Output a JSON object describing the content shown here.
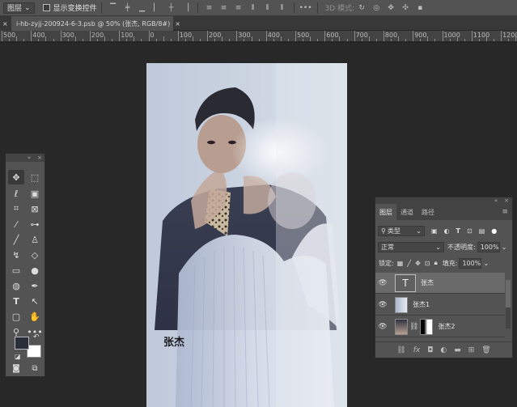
{
  "options_bar": {
    "layer_dropdown": "图层",
    "show_transform_label": "显示变换控件",
    "mode_3d_label": "3D 模式:"
  },
  "document": {
    "tab_title": "i-hb-zyjj-200924-6-3.psb @ 50% (张杰, RGB/8#)",
    "tab_close": "×",
    "canvas_text": "张杰"
  },
  "ruler": {
    "labels": [
      "500",
      "400",
      "300",
      "200",
      "100",
      "0",
      "100",
      "200",
      "300",
      "400",
      "500",
      "600",
      "700",
      "800",
      "900",
      "1000",
      "1100",
      "1200",
      "1300",
      "1400"
    ]
  },
  "toolbar": {
    "collapse": "«",
    "close": "×"
  },
  "layers_panel": {
    "collapse": "«",
    "close": "×",
    "tabs": [
      "图层",
      "通道",
      "路径"
    ],
    "filter_type": "类型",
    "blend_mode": "正常",
    "opacity_label": "不透明度:",
    "opacity_value": "100%",
    "lock_label": "锁定:",
    "fill_label": "填充:",
    "fill_value": "100%",
    "layers": [
      {
        "name": "张杰",
        "kind": "text",
        "selected": true
      },
      {
        "name": "张杰1",
        "kind": "image",
        "selected": false
      },
      {
        "name": "张杰2",
        "kind": "masked",
        "selected": false
      }
    ],
    "text_thumb_glyph": "T"
  },
  "colors": {
    "foreground": "#2a2d3a",
    "background": "#ffffff",
    "panel": "#535353",
    "canvas": "#282828"
  }
}
